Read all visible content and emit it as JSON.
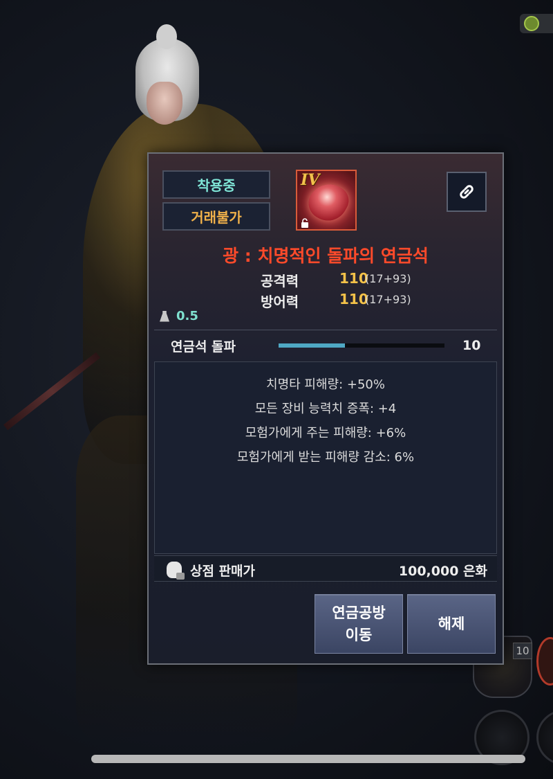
{
  "item": {
    "status_equipped": "착용중",
    "status_trade": "거래불가",
    "tier": "IV",
    "name": "광 : 치명적인 돌파의 연금석",
    "stats": [
      {
        "label": "공격력",
        "value": "110",
        "detail_base": "17",
        "detail_bonus": "+93"
      },
      {
        "label": "방어력",
        "value": "110",
        "detail_base": "17",
        "detail_bonus": "+93"
      }
    ],
    "weight": "0.5"
  },
  "breakthrough": {
    "label": "연금석 돌파",
    "progress_fraction": 0.4,
    "value": "10"
  },
  "effects": [
    "치명타 피해량: +50%",
    "모든 장비 능력치 증폭: +4",
    "모험가에게 주는 피해량: +6%",
    "모험가에게 받는 피해량 감소: 6%"
  ],
  "sell": {
    "label": "상점 판매가",
    "price": "100,000 은화"
  },
  "buttons": {
    "forge_line1": "연금공방",
    "forge_line2": "이동",
    "release": "해제"
  },
  "hud": {
    "emblem_level": "10"
  },
  "colors": {
    "item_name": "#ff4a2a",
    "equipped": "#7fe6d7",
    "untradable": "#f0b14a",
    "stat_value": "#f4c249",
    "weight": "#7fe0cf",
    "progress_fill": "#4fa8c4"
  },
  "icons": [
    "link-icon",
    "weight-icon",
    "money-bag-icon",
    "lock-icon",
    "gem-icon"
  ]
}
